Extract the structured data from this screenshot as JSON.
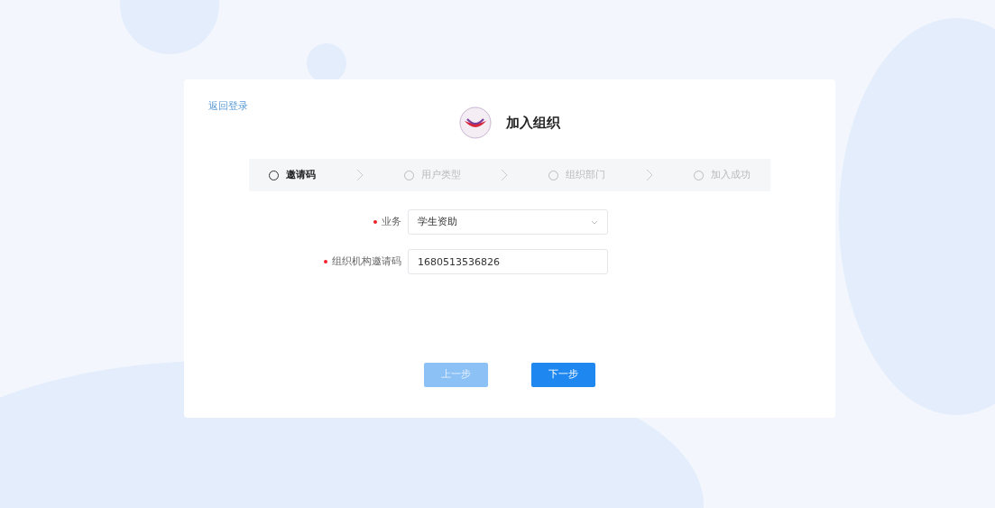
{
  "back_link": "返回登录",
  "title": "加入组织",
  "steps": [
    {
      "label": "邀请码",
      "selected": true
    },
    {
      "label": "用户类型",
      "selected": false
    },
    {
      "label": "组织部门",
      "selected": false
    },
    {
      "label": "加入成功",
      "selected": false
    }
  ],
  "fields": [
    {
      "kind": "select",
      "label": "业务",
      "required": true,
      "value": "学生资助"
    },
    {
      "kind": "input",
      "label": "组织机构邀请码",
      "required": true,
      "value": "1680513536826"
    }
  ],
  "buttons": [
    {
      "label": "上一步",
      "disabled": true
    },
    {
      "label": "下一步",
      "disabled": false
    }
  ]
}
